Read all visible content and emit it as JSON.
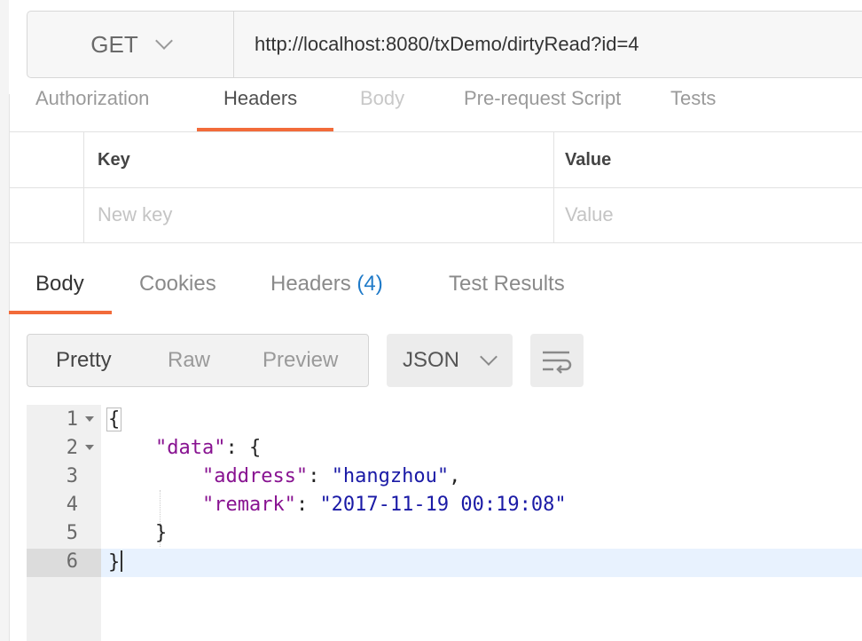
{
  "request": {
    "method": "GET",
    "url": "http://localhost:8080/txDemo/dirtyRead?id=4"
  },
  "request_tabs": [
    {
      "label": "Authorization",
      "active": false
    },
    {
      "label": "Headers",
      "active": true
    },
    {
      "label": "Body",
      "active": false
    },
    {
      "label": "Pre-request Script",
      "active": false
    },
    {
      "label": "Tests",
      "active": false
    }
  ],
  "headers_table": {
    "key_header": "Key",
    "value_header": "Value",
    "key_placeholder": "New key",
    "value_placeholder": "Value"
  },
  "response_tabs": [
    {
      "label": "Body",
      "active": true
    },
    {
      "label": "Cookies",
      "active": false
    },
    {
      "label": "Headers",
      "count": "(4)",
      "active": false
    },
    {
      "label": "Test Results",
      "active": false
    }
  ],
  "view_modes": [
    {
      "label": "Pretty",
      "active": true
    },
    {
      "label": "Raw",
      "active": false
    },
    {
      "label": "Preview",
      "active": false
    }
  ],
  "format": "JSON",
  "icons": {
    "method_dropdown": "chevron-down-icon",
    "format_dropdown": "chevron-down-icon",
    "wrap": "wrap-lines-icon",
    "fold": "fold-arrow-icon"
  },
  "code": {
    "line_numbers": [
      "1",
      "2",
      "3",
      "4",
      "5",
      "6"
    ],
    "open_brace": "{",
    "data_key": "\"data\"",
    "colon_open": ": {",
    "address_key": "\"address\"",
    "address_value": "\"hangzhou\"",
    "remark_key": "\"remark\"",
    "remark_value": "\"2017-11-19 00:19:08\"",
    "sep": ": ",
    "comma": ",",
    "close_inner": "}",
    "close_outer": "}"
  },
  "colors": {
    "accent": "#f26b3a",
    "count": "#1f7ac8",
    "json_key": "#881391",
    "json_string": "#1a1aa6",
    "active_line": "#e8f2fe"
  }
}
